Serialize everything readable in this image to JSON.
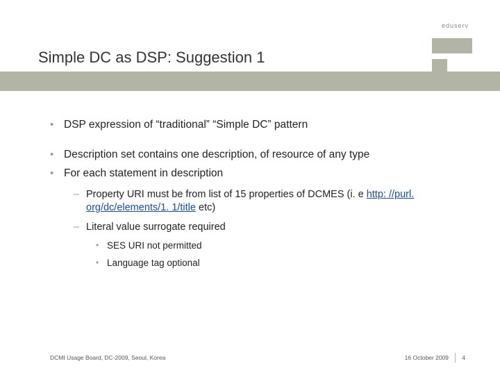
{
  "brand": "eduserv",
  "title": "Simple DC as DSP: Suggestion 1",
  "bullets": [
    {
      "text": "DSP expression of “traditional” “Simple DC” pattern"
    },
    {
      "text": "Description set contains one description, of resource of any type"
    },
    {
      "text": "For each statement in description",
      "sub": [
        {
          "pre": "Property URI must be from list of 15 properties of DCMES (i. e ",
          "link": "http: //purl. org/dc/elements/1. 1/title",
          "post": " etc)"
        },
        {
          "text": "Literal value surrogate required",
          "sub": [
            "SES URI not permitted",
            "Language tag optional"
          ]
        }
      ]
    }
  ],
  "footer": {
    "left": "DCMI Usage Board, DC-2009, Seoul, Korea",
    "date": "16 October 2009",
    "page": "4"
  }
}
